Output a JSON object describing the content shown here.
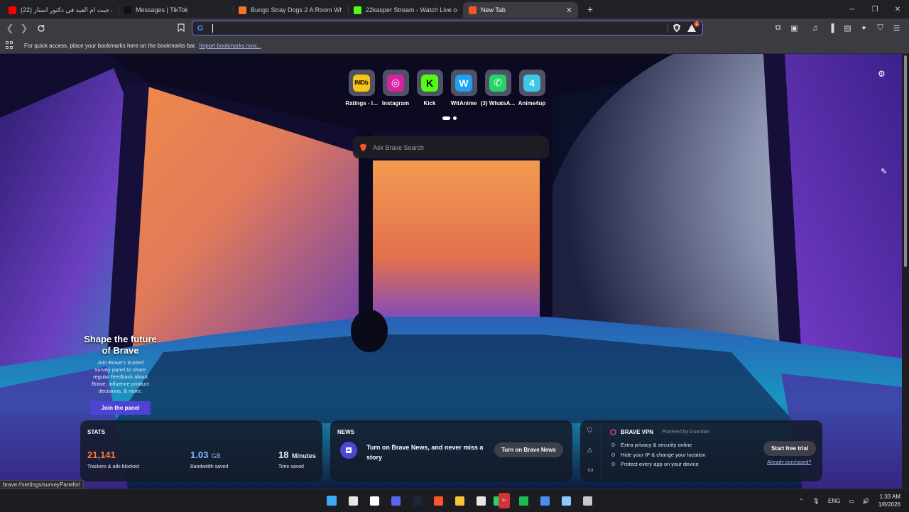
{
  "tabs": [
    {
      "title": "(22) قصة جبت ام العيد في دكتور استار",
      "favicon": "youtube-icon",
      "color": "#ff0000",
      "active": false
    },
    {
      "title": "Messages | TikTok",
      "favicon": "tiktok-icon",
      "color": "#111111",
      "active": false
    },
    {
      "title": "Bungo Stray Dogs 2 A Room Where W",
      "favicon": "crunchyroll-icon",
      "color": "#f47521",
      "active": false
    },
    {
      "title": "22kasper Stream - Watch Live on Kick",
      "favicon": "kick-icon",
      "color": "#53fc18",
      "active": false
    },
    {
      "title": "New Tab",
      "favicon": "brave-lion-icon",
      "color": "#fb542b",
      "active": true
    }
  ],
  "toolbar": {
    "omnibox_value": "",
    "rewards_badge": "1"
  },
  "bookmarks_bar": {
    "hint": "For quick access, place your bookmarks here on the bookmarks bar.",
    "import_link": "Import bookmarks now..."
  },
  "top_sites": [
    {
      "label": "Ratings - I...",
      "icon": "imdb-icon",
      "glyph": "IMDb",
      "bg": "#f5c518",
      "fg": "#000000"
    },
    {
      "label": "Instagram",
      "icon": "instagram-icon",
      "glyph": "◎",
      "bg": "#d6249f",
      "fg": "#ffffff"
    },
    {
      "label": "Kick",
      "icon": "kick-icon",
      "glyph": "K",
      "bg": "#53fc18",
      "fg": "#000000"
    },
    {
      "label": "WitAnime",
      "icon": "witanime-icon",
      "glyph": "W",
      "bg": "#1da1f2",
      "fg": "#ffffff"
    },
    {
      "label": "(3) WhatsA...",
      "icon": "whatsapp-icon",
      "glyph": "✆",
      "bg": "#25d366",
      "fg": "#ffffff"
    },
    {
      "label": "Anime4up",
      "icon": "anime4up-icon",
      "glyph": "4",
      "bg": "#3cc8e8",
      "fg": "#ffffff"
    }
  ],
  "search": {
    "placeholder": "Ask Brave Search"
  },
  "promo": {
    "title": "Shape the future of Brave",
    "body": "Join Brave's trusted survey panel to share regular feedback about Brave, influence product decisions, & more.",
    "button": "Join the panel"
  },
  "stats": {
    "title": "STATS",
    "trackers": {
      "value": "21,141",
      "label": "Trackers & ads blocked",
      "color": "#fb7a3a"
    },
    "bandwidth": {
      "value": "1.03",
      "unit": "GB",
      "label": "Bandwidth saved",
      "color": "#8ab4ff"
    },
    "time": {
      "value": "18",
      "unit": "Minutes",
      "label": "Time saved"
    }
  },
  "news": {
    "title": "NEWS",
    "text": "Turn on Brave News, and never miss a story",
    "button": "Turn on Brave News"
  },
  "vpn": {
    "brand": "BRAVE VPN",
    "powered": "Powered by Guardian",
    "features": [
      "Extra privacy & security online",
      "Hide your IP & change your location",
      "Protect every app on your device"
    ],
    "trial_button": "Start free trial",
    "purchased_link": "Already purchased?"
  },
  "status_url": "brave://settings/surveyPanelist",
  "taskbar": {
    "apps": [
      {
        "name": "windows-start-icon",
        "color": "#3fa9f5"
      },
      {
        "name": "epic-games-icon",
        "color": "#e6e6e6"
      },
      {
        "name": "capcut-icon",
        "color": "#ffffff"
      },
      {
        "name": "discord-like-icon",
        "color": "#5865f2"
      },
      {
        "name": "steam-icon",
        "color": "#1b2838"
      },
      {
        "name": "brave-icon",
        "color": "#fb542b"
      },
      {
        "name": "file-explorer-icon",
        "color": "#f8c33a"
      },
      {
        "name": "store-icon",
        "color": "#e6e6e6"
      },
      {
        "name": "whatsapp-icon",
        "color": "#25d366"
      },
      {
        "name": "spotify-icon",
        "color": "#1db954"
      },
      {
        "name": "app-icon",
        "color": "#4b8df5"
      },
      {
        "name": "notepad-icon",
        "color": "#8fc7ff"
      },
      {
        "name": "snipping-tool-icon",
        "color": "#c8c8c8"
      }
    ],
    "badge": "9+"
  },
  "tray": {
    "language": "ENG",
    "time": "1:33 AM",
    "date": "1/8/2026"
  }
}
